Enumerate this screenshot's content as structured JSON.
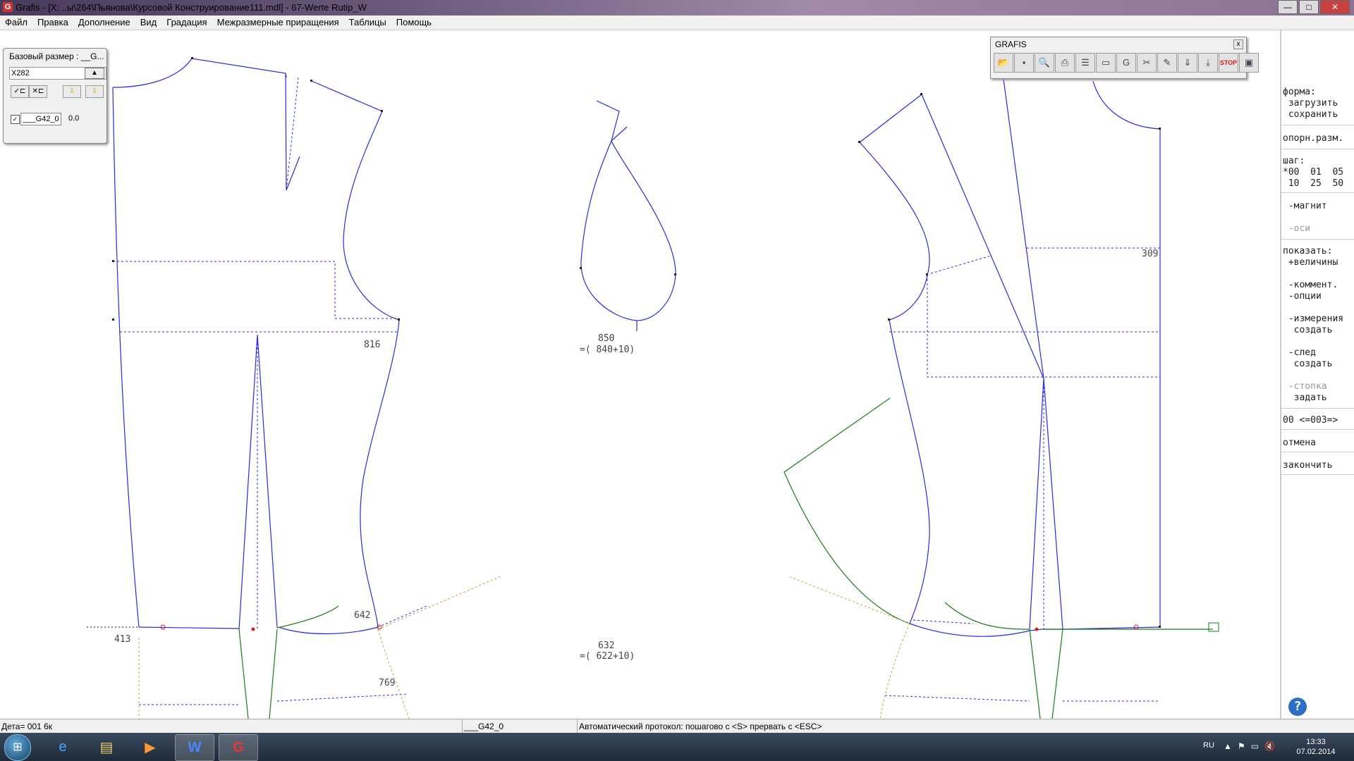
{
  "window": {
    "title": "Grafis - [X: ..ы\\264\\Пьянова\\Курсовой Конструирование111.mdl] - 67-Werte Rutip_W",
    "app_icon": "G",
    "minimize_label": "—",
    "maximize_label": "□",
    "close_label": "✕"
  },
  "menu": {
    "items": [
      "Файл",
      "Правка",
      "Дополнение",
      "Вид",
      "Градация",
      "Межразмерные приращения",
      "Таблицы",
      "Помощь"
    ]
  },
  "base_panel": {
    "header": "Базовый размер : __G...",
    "size_value": "X282",
    "part_name": "___G42_0",
    "part_value": "0.0"
  },
  "grafis_toolbar": {
    "title": "GRAFIS",
    "close": "x",
    "tools": [
      "open-folder-icon",
      "save-icon",
      "zoom-icon",
      "print-icon",
      "list-icon",
      "measure-icon",
      "grafis-icon",
      "scissors-icon",
      "edit-icon",
      "download-icon",
      "download-alt-icon",
      "stop-icon",
      "monitor-icon"
    ]
  },
  "right_panel": {
    "forma": "форма:",
    "zagruzit": " загрузить",
    "sohranit": " сохранить",
    "opor": "опорн.разм.",
    "shag": "шаг:",
    "shag_row1": "*00  01  05",
    "shag_row2": " 10  25  50",
    "magnit": " -магнит",
    "osi": " -оси",
    "pokazat": "показать:",
    "velichiny": " +величины",
    "komment": " -коммент.",
    "opcii": " -опции",
    "izmereniya": " -измерения",
    "sozdat1": "  создать",
    "sled": " -след",
    "sozdat2": "  создать",
    "stopka": " -стопка",
    "zadat": "  задать",
    "counter": "00 <=003=>",
    "otmena": "отмена",
    "zakonchit": "закончить",
    "help": "?"
  },
  "drawing_labels": {
    "l816": "816",
    "l850": "850",
    "l850b": "=( 840+10)",
    "l642": "642",
    "l413": "413",
    "l632": "632",
    "l632b": "=( 622+10)",
    "l769": "769",
    "l309": "309"
  },
  "colors": {
    "pattern_line": "#2b2bdc",
    "construction_dash": "#2b2bdc",
    "green_line": "#1a7a1a",
    "guide_dash": "#c9a040",
    "grafis_stop": "#d02020"
  },
  "status": {
    "detail": "Дета= 001  6к",
    "part": "___G42_0",
    "protocol": "Автоматический протокол: пошагово с <S> прервать с <ESC>"
  },
  "taskbar": {
    "lang": "RU",
    "time": "13:33",
    "date": "07.02.2014"
  }
}
